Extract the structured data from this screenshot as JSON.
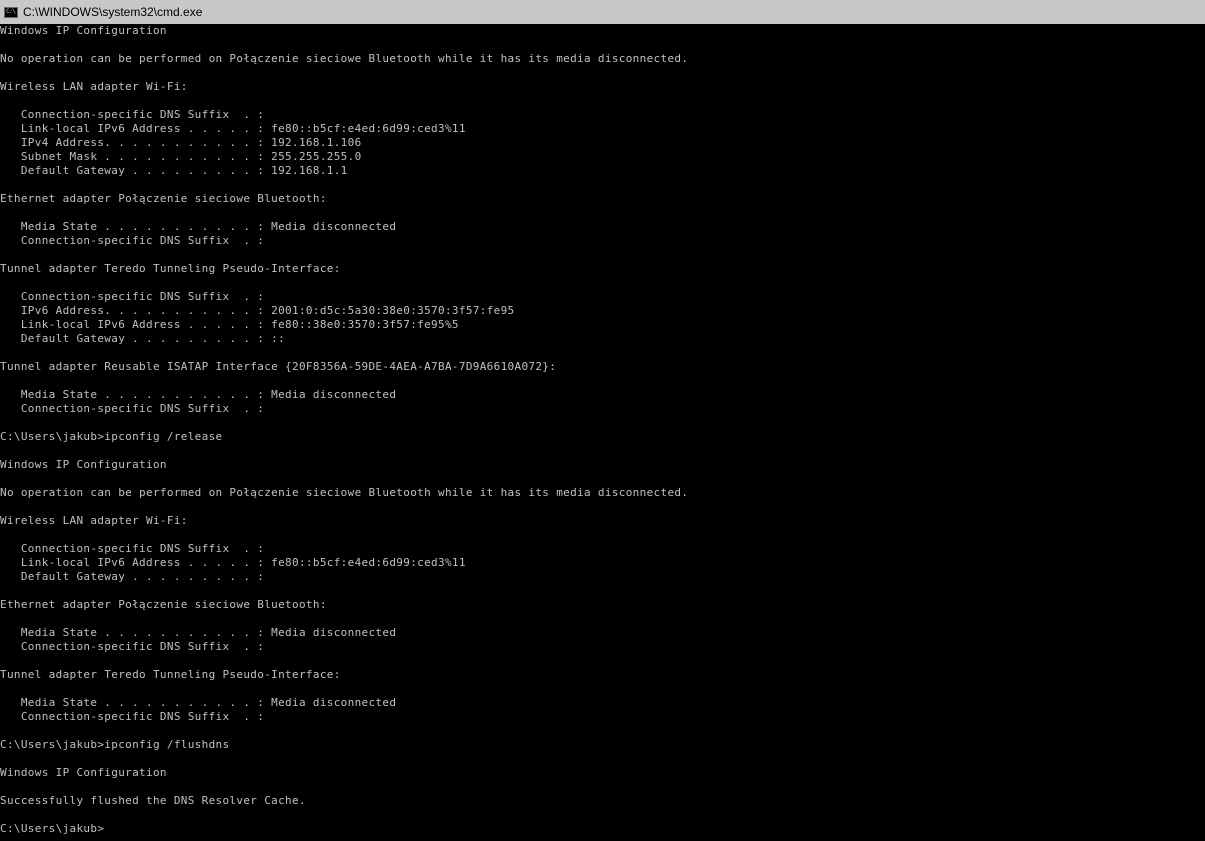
{
  "window": {
    "title": "C:\\WINDOWS\\system32\\cmd.exe",
    "icon": "cmd-icon"
  },
  "console": {
    "lines": [
      "Windows IP Configuration",
      "",
      "No operation can be performed on Połączenie sieciowe Bluetooth while it has its media disconnected.",
      "",
      "Wireless LAN adapter Wi-Fi:",
      "",
      "   Connection-specific DNS Suffix  . :",
      "   Link-local IPv6 Address . . . . . : fe80::b5cf:e4ed:6d99:ced3%11",
      "   IPv4 Address. . . . . . . . . . . : 192.168.1.106",
      "   Subnet Mask . . . . . . . . . . . : 255.255.255.0",
      "   Default Gateway . . . . . . . . . : 192.168.1.1",
      "",
      "Ethernet adapter Połączenie sieciowe Bluetooth:",
      "",
      "   Media State . . . . . . . . . . . : Media disconnected",
      "   Connection-specific DNS Suffix  . :",
      "",
      "Tunnel adapter Teredo Tunneling Pseudo-Interface:",
      "",
      "   Connection-specific DNS Suffix  . :",
      "   IPv6 Address. . . . . . . . . . . : 2001:0:d5c:5a30:38e0:3570:3f57:fe95",
      "   Link-local IPv6 Address . . . . . : fe80::38e0:3570:3f57:fe95%5",
      "   Default Gateway . . . . . . . . . : ::",
      "",
      "Tunnel adapter Reusable ISATAP Interface {20F8356A-59DE-4AEA-A7BA-7D9A6610A072}:",
      "",
      "   Media State . . . . . . . . . . . : Media disconnected",
      "   Connection-specific DNS Suffix  . :",
      "",
      "C:\\Users\\jakub>ipconfig /release",
      "",
      "Windows IP Configuration",
      "",
      "No operation can be performed on Połączenie sieciowe Bluetooth while it has its media disconnected.",
      "",
      "Wireless LAN adapter Wi-Fi:",
      "",
      "   Connection-specific DNS Suffix  . :",
      "   Link-local IPv6 Address . . . . . : fe80::b5cf:e4ed:6d99:ced3%11",
      "   Default Gateway . . . . . . . . . :",
      "",
      "Ethernet adapter Połączenie sieciowe Bluetooth:",
      "",
      "   Media State . . . . . . . . . . . : Media disconnected",
      "   Connection-specific DNS Suffix  . :",
      "",
      "Tunnel adapter Teredo Tunneling Pseudo-Interface:",
      "",
      "   Media State . . . . . . . . . . . : Media disconnected",
      "   Connection-specific DNS Suffix  . :",
      "",
      "C:\\Users\\jakub>ipconfig /flushdns",
      "",
      "Windows IP Configuration",
      "",
      "Successfully flushed the DNS Resolver Cache.",
      "",
      "C:\\Users\\jakub>"
    ]
  },
  "colors": {
    "console_background": "#000000",
    "console_text": "#c0c0c0",
    "titlebar_background": "#c8c8c8",
    "titlebar_text": "#000000"
  }
}
